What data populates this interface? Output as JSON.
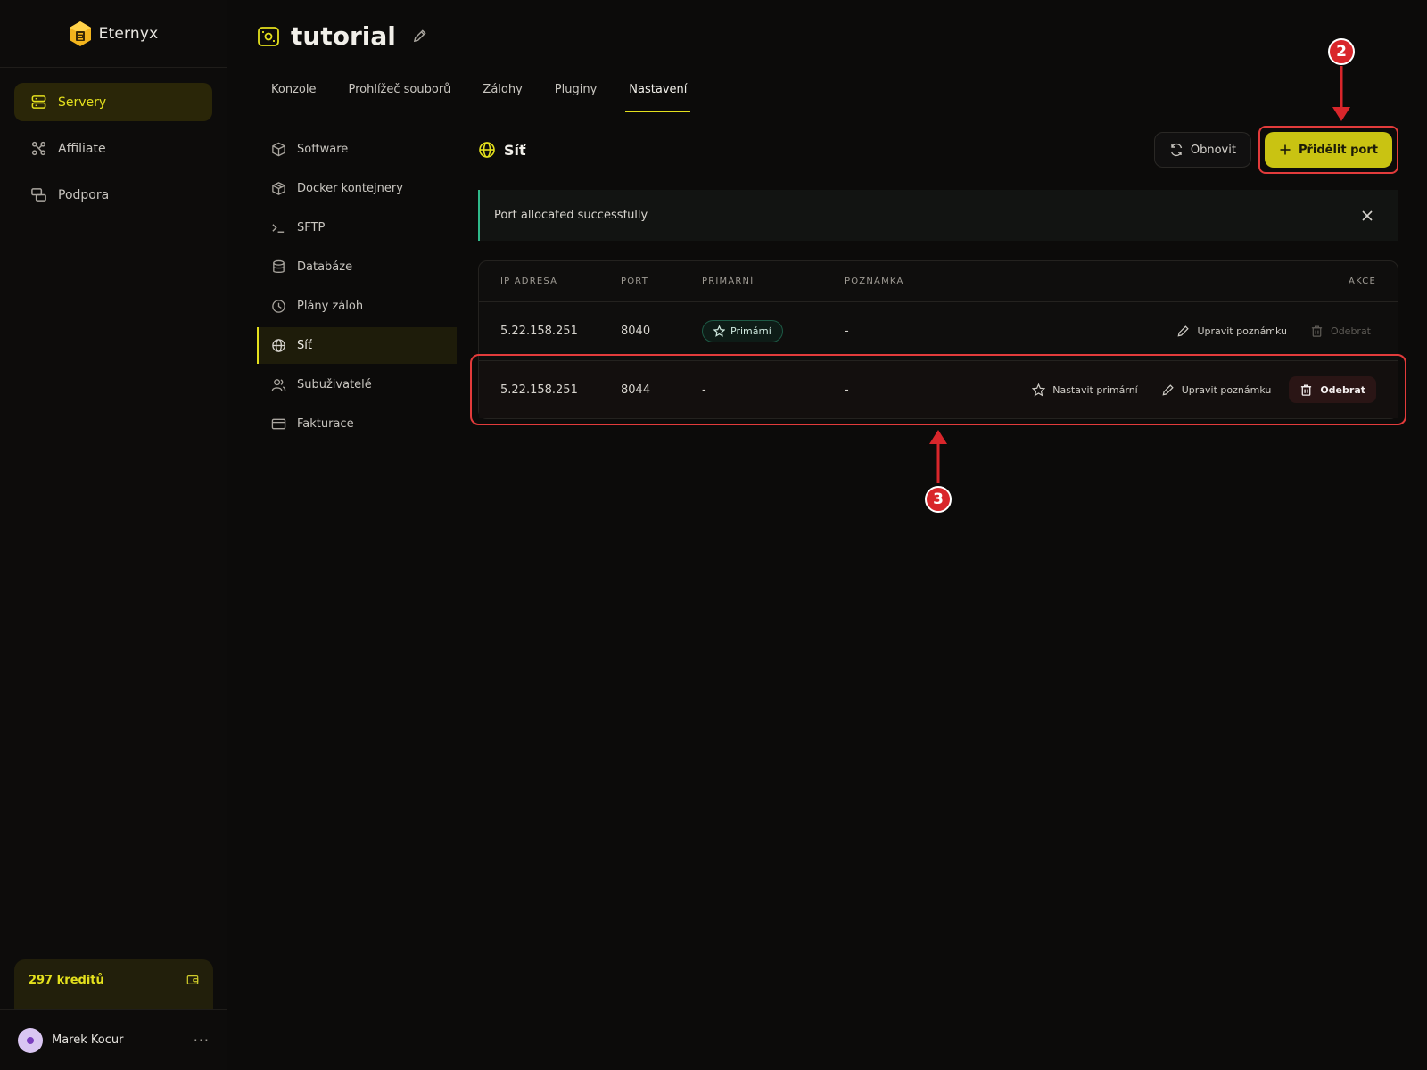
{
  "brand": {
    "name": "Eternyx"
  },
  "sidebar": {
    "items": [
      {
        "label": "Servery",
        "icon": "server-icon",
        "active": true
      },
      {
        "label": "Affiliate",
        "icon": "affiliate-icon",
        "active": false
      },
      {
        "label": "Podpora",
        "icon": "support-icon",
        "active": false
      }
    ],
    "credits": "297 kreditů",
    "user": {
      "name": "Marek Kocur",
      "more": "···"
    }
  },
  "header": {
    "title": "tutorial",
    "tabs": [
      "Konzole",
      "Prohlížeč souborů",
      "Zálohy",
      "Pluginy",
      "Nastavení"
    ],
    "active_tab": "Nastavení"
  },
  "settings_menu": [
    {
      "label": "Software",
      "icon": "package-icon"
    },
    {
      "label": "Docker kontejnery",
      "icon": "docker-box-icon"
    },
    {
      "label": "SFTP",
      "icon": "terminal-icon"
    },
    {
      "label": "Databáze",
      "icon": "database-icon"
    },
    {
      "label": "Plány záloh",
      "icon": "clock-icon"
    },
    {
      "label": "Síť",
      "icon": "globe-icon",
      "active": true
    },
    {
      "label": "Subuživatelé",
      "icon": "users-icon"
    },
    {
      "label": "Fakturace",
      "icon": "credit-card-icon"
    }
  ],
  "network": {
    "title": "Síť",
    "refresh_label": "Obnovit",
    "allocate_label": "Přidělit port",
    "alert": "Port allocated successfully",
    "columns": [
      "IP ADRESA",
      "PORT",
      "PRIMÁRNÍ",
      "POZNÁMKA",
      "AKCE"
    ],
    "rows": [
      {
        "ip": "5.22.158.251",
        "port": "8040",
        "primary_badge": "Primární",
        "note": "-",
        "edit_note": "Upravit poznámku",
        "remove": "Odebrat"
      },
      {
        "ip": "5.22.158.251",
        "port": "8044",
        "primary": "-",
        "note": "-",
        "set_primary": "Nastavit primární",
        "edit_note": "Upravit poznámku",
        "remove": "Odebrat"
      }
    ]
  },
  "annotations": {
    "marker_2": "2",
    "marker_3": "3"
  },
  "colors": {
    "accent": "#e4e01d",
    "button": "#c9c312",
    "success": "#2fb98a",
    "annotation": "#d9262b"
  }
}
